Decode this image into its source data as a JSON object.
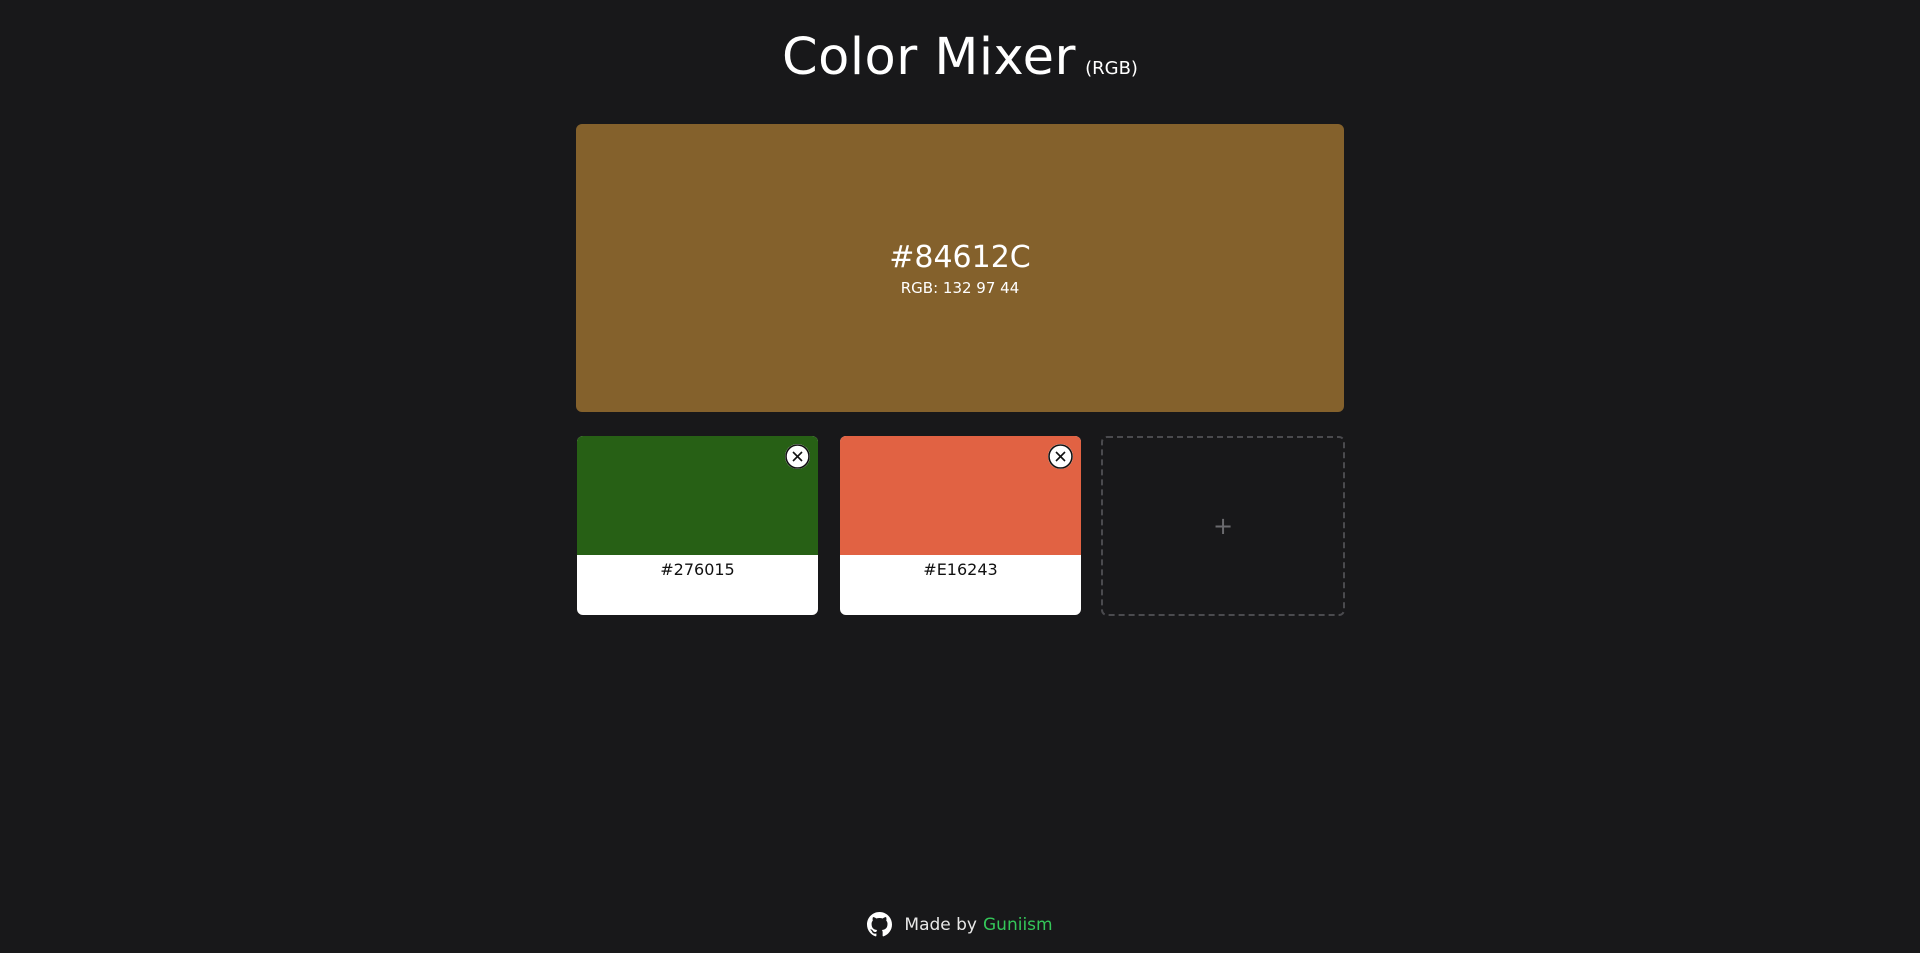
{
  "header": {
    "title": "Color Mixer",
    "subtitle": "(RGB)"
  },
  "result": {
    "hex": "#84612C",
    "rgb_label": "RGB: 132 97 44",
    "color": "#84612C"
  },
  "colors": [
    {
      "hex": "#276015",
      "color": "#276015",
      "remove_icon": "close-circle-icon"
    },
    {
      "hex": "#E16243",
      "color": "#E16243",
      "remove_icon": "close-circle-icon"
    }
  ],
  "add_card": {
    "icon": "plus-icon",
    "symbol": "+"
  },
  "footer": {
    "icon": "github-icon",
    "made_by": "Made by",
    "author": "Guniism",
    "author_color": "#34c759"
  }
}
